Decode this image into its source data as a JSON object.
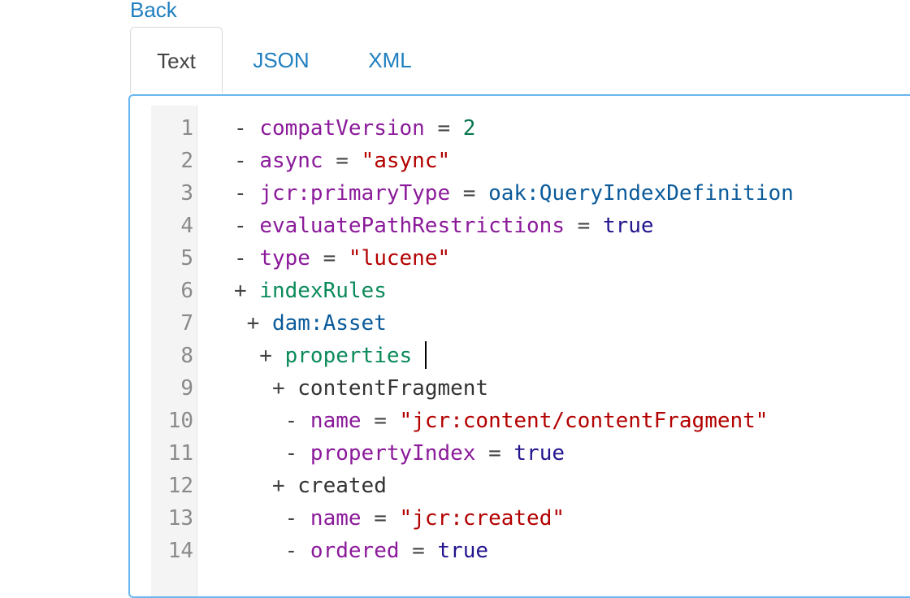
{
  "nav": {
    "back_label": "Back"
  },
  "tabs": [
    {
      "label": "Text",
      "active": true
    },
    {
      "label": "JSON",
      "active": false
    },
    {
      "label": "XML",
      "active": false
    }
  ],
  "editor": {
    "lines": [
      {
        "num": "1",
        "prefix": "- ",
        "key": "compatVersion",
        "eq": " = ",
        "value": "2",
        "value_type": "num"
      },
      {
        "num": "2",
        "prefix": "- ",
        "key": "async",
        "eq": " = ",
        "value": "\"async\"",
        "value_type": "str"
      },
      {
        "num": "3",
        "prefix": "- ",
        "key": "jcr:primaryType",
        "eq": " = ",
        "value": "oak:QueryIndexDefinition",
        "value_type": "name"
      },
      {
        "num": "4",
        "prefix": "- ",
        "key": "evaluatePathRestrictions",
        "eq": " = ",
        "value": "true",
        "value_type": "bool"
      },
      {
        "num": "5",
        "prefix": "- ",
        "key": "type",
        "eq": " = ",
        "value": "\"lucene\"",
        "value_type": "str"
      },
      {
        "num": "6",
        "prefix": "+ ",
        "node": "indexRules",
        "node_type": "node"
      },
      {
        "num": "7",
        "prefix": " + ",
        "node": "dam:Asset",
        "node_type": "name"
      },
      {
        "num": "8",
        "prefix": "  + ",
        "node": "properties",
        "node_type": "node",
        "cursor": true
      },
      {
        "num": "9",
        "prefix": "   + ",
        "node": "contentFragment",
        "node_type": "plain"
      },
      {
        "num": "10",
        "prefix": "    - ",
        "key": "name",
        "eq": " = ",
        "value": "\"jcr:content/contentFragment\"",
        "value_type": "str"
      },
      {
        "num": "11",
        "prefix": "    - ",
        "key": "propertyIndex",
        "eq": " = ",
        "value": "true",
        "value_type": "bool"
      },
      {
        "num": "12",
        "prefix": "   + ",
        "node": "created",
        "node_type": "plain"
      },
      {
        "num": "13",
        "prefix": "    - ",
        "key": "name",
        "eq": " = ",
        "value": "\"jcr:created\"",
        "value_type": "str"
      },
      {
        "num": "14",
        "prefix": "    - ",
        "key": "ordered",
        "eq": " = ",
        "value": "true",
        "value_type": "bool"
      }
    ]
  }
}
